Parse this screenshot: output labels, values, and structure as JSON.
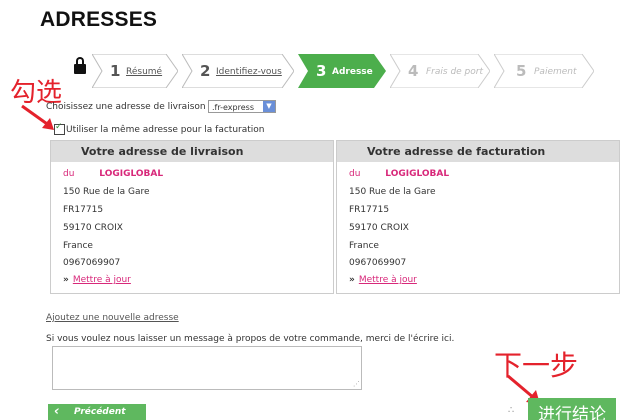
{
  "page": {
    "title": "ADRESSES"
  },
  "steps": [
    {
      "num": "1",
      "label": "Résumé",
      "state": "done"
    },
    {
      "num": "2",
      "label": "Identifiez-vous",
      "state": "done"
    },
    {
      "num": "3",
      "label": "Adresse",
      "state": "active"
    },
    {
      "num": "4",
      "label": "Frais de port",
      "state": "inactive"
    },
    {
      "num": "5",
      "label": "Paiement",
      "state": "inactive"
    }
  ],
  "colors": {
    "active_step": "#4cae4c",
    "accent_pink": "#d8287a",
    "annotation_red": "#e4222c",
    "button_green": "#5fb85f"
  },
  "delivery": {
    "choose_label": "Choisissez une adresse de livraison :",
    "selected": ".fr-express"
  },
  "same_address": {
    "label": "Utiliser la même adresse pour la facturation",
    "checked": true
  },
  "cards": {
    "delivery": {
      "title": "Votre adresse de livraison",
      "name_prefix": "du",
      "company": "LOGIGLOBAL",
      "street": "150 Rue de la Gare",
      "code": "FR17715",
      "city": "59170 CROIX",
      "country": "France",
      "phone": "0967069907",
      "update_link": "Mettre à jour"
    },
    "billing": {
      "title": "Votre adresse de facturation",
      "name_prefix": "du",
      "company": "LOGIGLOBAL",
      "street": "150 Rue de la Gare",
      "code": "FR17715",
      "city": "59170 CROIX",
      "country": "France",
      "phone": "0967069907",
      "update_link": "Mettre à jour"
    }
  },
  "add_address_link": "Ajoutez une nouvelle adresse",
  "message_prompt": "Si vous voulez nous laisser un message à propos de votre commande, merci de l'écrire ici.",
  "annotations": {
    "check_hint": "勾选",
    "next_step_hint": "下一步"
  },
  "buttons": {
    "prev": "Précédent",
    "next": "进行结论"
  }
}
